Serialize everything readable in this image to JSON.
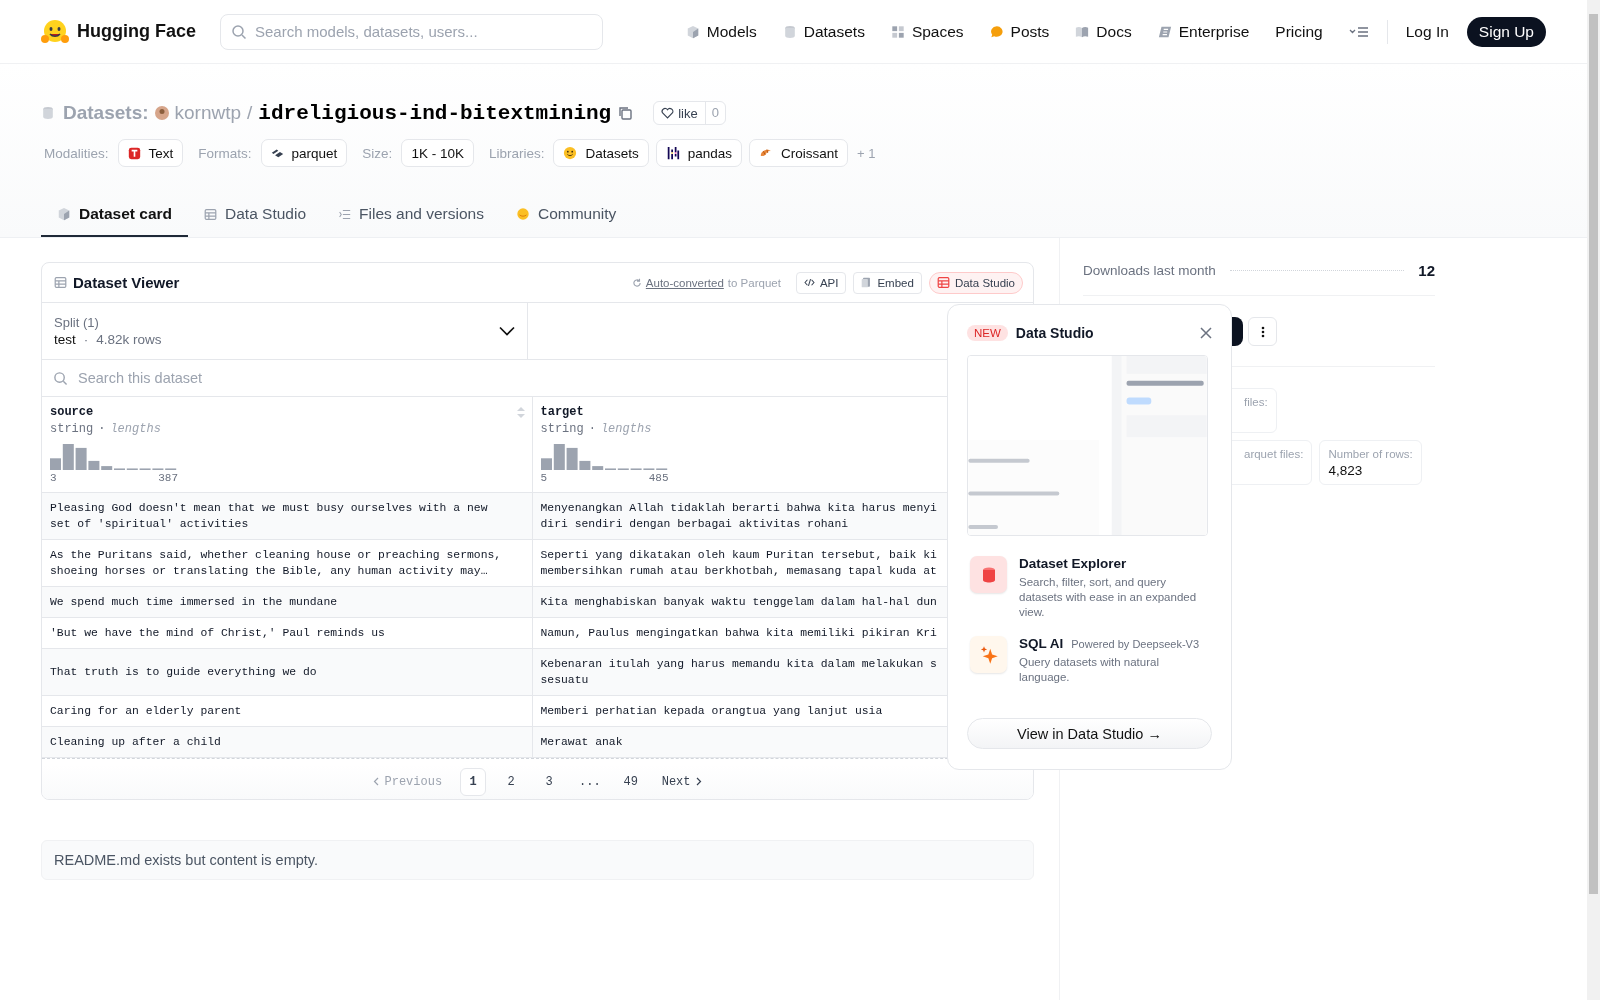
{
  "header": {
    "brand": "Hugging Face",
    "search": {
      "placeholder": "Search models, datasets, users..."
    },
    "nav": [
      {
        "label": "Models",
        "kind": "cube"
      },
      {
        "label": "Datasets",
        "kind": "database"
      },
      {
        "label": "Spaces",
        "kind": "grid"
      },
      {
        "label": "Posts",
        "kind": "bubble"
      },
      {
        "label": "Docs",
        "kind": "book"
      },
      {
        "label": "Enterprise",
        "kind": "enterprise"
      },
      {
        "label": "Pricing",
        "kind": "plain"
      }
    ],
    "login": "Log In",
    "signup": "Sign Up"
  },
  "repo": {
    "section": "Datasets:",
    "owner": "kornwtp",
    "separator": "/",
    "name": "idreligious-ind-bitextmining",
    "like_label": "like",
    "like_count": "0"
  },
  "tag_groups": [
    {
      "label": "Modalities:",
      "items": [
        {
          "text": "Text",
          "kind": "text"
        }
      ]
    },
    {
      "label": "Formats:",
      "items": [
        {
          "text": "parquet",
          "kind": "parquet"
        }
      ]
    },
    {
      "label": "Size:",
      "items": [
        {
          "text": "1K - 10K",
          "kind": "plain"
        }
      ]
    },
    {
      "label": "Libraries:",
      "items": [
        {
          "text": "Datasets",
          "kind": "hf"
        },
        {
          "text": "pandas",
          "kind": "pandas"
        },
        {
          "text": "Croissant",
          "kind": "croissant"
        }
      ]
    }
  ],
  "more_tags": "+ 1",
  "tabs": [
    {
      "label": "Dataset card",
      "kind": "cube",
      "selected": true
    },
    {
      "label": "Data Studio",
      "kind": "table",
      "selected": false
    },
    {
      "label": "Files and versions",
      "kind": "files",
      "selected": false
    },
    {
      "label": "Community",
      "kind": "community",
      "selected": false
    }
  ],
  "viewer": {
    "title": "Dataset Viewer",
    "auto_link": "Auto-converted",
    "auto_rest": "to Parquet",
    "buttons": [
      {
        "label": "API",
        "kind": "code"
      },
      {
        "label": "Embed",
        "kind": "copy"
      },
      {
        "label": "Data Studio",
        "kind": "accent"
      }
    ],
    "split": {
      "label": "Split (1)",
      "value": "test",
      "dot": "·",
      "rows": "4.82k rows"
    },
    "search": {
      "placeholder": "Search this dataset"
    },
    "columns": [
      {
        "name": "source",
        "type": "string",
        "dot": "·",
        "stat": "lengths",
        "min": "3",
        "max": "387"
      },
      {
        "name": "target",
        "type": "string",
        "dot": "·",
        "stat": "lengths",
        "min": "5",
        "max": "485"
      }
    ],
    "rows": [
      [
        "Pleasing God doesn't mean that we must busy ourselves with a new\nset of 'spiritual' activities",
        "Menyenangkan Allah tidaklah berarti bahwa kita harus menyi\ndiri sendiri dengan berbagai aktivitas rohani"
      ],
      [
        "As the Puritans said, whether cleaning house or preaching sermons,\nshoeing horses or translating the Bible, any human activity may…",
        "Seperti yang dikatakan oleh kaum Puritan tersebut, baik ki\nmembersihkan rumah atau berkhotbah, memasang tapal kuda at"
      ],
      [
        "We spend much time immersed in the mundane",
        "Kita menghabiskan banyak waktu tenggelam dalam hal-hal dun"
      ],
      [
        "'But we have the mind of Christ,' Paul reminds us",
        "Namun, Paulus mengingatkan bahwa kita memiliki pikiran Kri"
      ],
      [
        "That truth is to guide everything we do",
        "Kebenaran itulah yang harus memandu kita dalam melakukan s\nsesuatu"
      ],
      [
        "Caring for an elderly parent",
        "Memberi perhatian kepada orangtua yang lanjut usia"
      ],
      [
        "Cleaning up after a child",
        "Merawat anak"
      ]
    ],
    "pagination": {
      "previous": {
        "label": "Previous",
        "disabled": true
      },
      "pages": [
        {
          "label": "1",
          "selected": true
        },
        {
          "label": "2",
          "selected": false
        },
        {
          "label": "3",
          "selected": false
        },
        {
          "label": "...",
          "selected": false
        },
        {
          "label": "49",
          "selected": false
        }
      ],
      "next": {
        "label": "Next",
        "disabled": false
      }
    }
  },
  "readme": "README.md exists but content is empty.",
  "sidebar": {
    "downloads_label": "Downloads last month",
    "downloads_value": "12",
    "cards": [
      {
        "label": "files:"
      },
      {
        "label": "arquet files:"
      },
      {
        "label": "Number of rows:",
        "value": "4,823"
      }
    ]
  },
  "popup": {
    "badge": "NEW",
    "title": "Data Studio",
    "features": [
      {
        "title": "Dataset Explorer",
        "kind": "database",
        "description": "Search, filter, sort, and query datasets with ease in an expanded view."
      },
      {
        "title": "SQL AI",
        "note": "Powered by Deepseek-V3",
        "kind": "sparkle",
        "description": "Query datasets with natural language."
      }
    ],
    "cta": "View in Data Studio →"
  }
}
